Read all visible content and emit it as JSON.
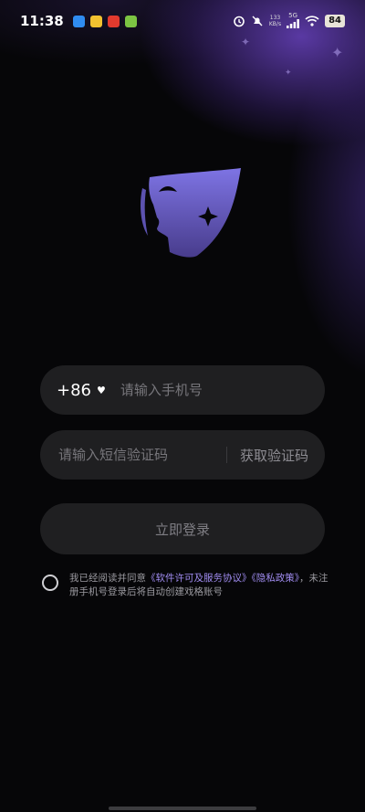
{
  "status_bar": {
    "time": "11:38",
    "net_speed": "133",
    "net_unit": "KB/s",
    "network_type": "5G",
    "battery": "84"
  },
  "login": {
    "country_code": "+86",
    "phone_placeholder": "请输入手机号",
    "sms_placeholder": "请输入短信验证码",
    "get_code_label": "获取验证码",
    "login_label": "立即登录"
  },
  "agreement": {
    "prefix": "我已经阅读并同意",
    "license_link": "《软件许可及服务协议》",
    "privacy_link": "《隐私政策》",
    "suffix": "，未注册手机号登录后将自动创建戏格账号"
  },
  "colors": {
    "accent": "#a08cf0",
    "background": "#060608",
    "pill": "#1f1f21",
    "logo_top": "#7c72e0",
    "logo_bottom": "#4a3f8e"
  },
  "icons": [
    "mask-logo-icon",
    "heart-icon",
    "alarm-icon",
    "mute-icon",
    "wifi-icon",
    "signal-icon"
  ]
}
